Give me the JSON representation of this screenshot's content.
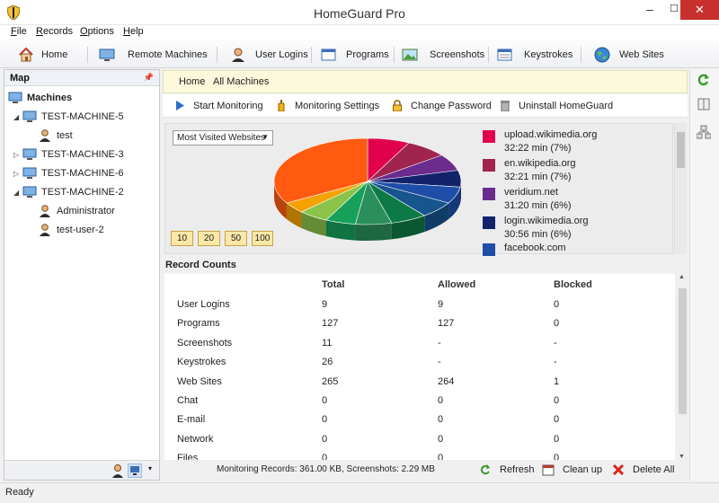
{
  "window": {
    "title": "HomeGuard Pro"
  },
  "menu": [
    {
      "label": "File",
      "key": "F"
    },
    {
      "label": "Records",
      "key": "R"
    },
    {
      "label": "Options",
      "key": "O"
    },
    {
      "label": "Help",
      "key": "H"
    }
  ],
  "toolbar": {
    "home": "Home",
    "remote_machines": "Remote Machines",
    "user_logins": "User Logins",
    "programs": "Programs",
    "screenshots": "Screenshots",
    "keystrokes": "Keystrokes",
    "web_sites": "Web Sites"
  },
  "map": {
    "title": "Map",
    "root": "Machines",
    "nodes": [
      {
        "label": "TEST-MACHINE-5",
        "type": "machine",
        "expanded": true
      },
      {
        "label": "test",
        "type": "user"
      },
      {
        "label": "TEST-MACHINE-3",
        "type": "machine",
        "expanded": false
      },
      {
        "label": "TEST-MACHINE-6",
        "type": "machine",
        "expanded": false
      },
      {
        "label": "TEST-MACHINE-2",
        "type": "machine",
        "expanded": true
      },
      {
        "label": "Administrator",
        "type": "user"
      },
      {
        "label": "test-user-2",
        "type": "user"
      }
    ]
  },
  "breadcrumb": {
    "home": "Home",
    "current": "All Machines"
  },
  "actions": {
    "start_monitoring": "Start Monitoring",
    "monitoring_settings": "Monitoring Settings",
    "change_password": "Change Password",
    "uninstall": "Uninstall HomeGuard"
  },
  "chart_panel": {
    "dropdown_value": "Most Visited Websites",
    "top_buttons": [
      "10",
      "20",
      "50",
      "100"
    ]
  },
  "chart_data": {
    "type": "pie",
    "slices": [
      {
        "label": "upload.wikimedia.org",
        "value": 7,
        "color": "#e0004b"
      },
      {
        "label": "en.wikipedia.org",
        "value": 7,
        "color": "#a0244e"
      },
      {
        "label": "veridium.net",
        "value": 6,
        "color": "#6b2c8e"
      },
      {
        "label": "login.wikimedia.org",
        "value": 6,
        "color": "#13236b"
      },
      {
        "label": "facebook.com",
        "value": 6,
        "color": "#1f4ea8"
      },
      {
        "label": "",
        "value": 6,
        "color": "#16558e"
      },
      {
        "label": "",
        "value": 6,
        "color": "#0d7a46"
      },
      {
        "label": "",
        "value": 6,
        "color": "#2a8f5a"
      },
      {
        "label": "",
        "value": 5,
        "color": "#16a05a"
      },
      {
        "label": "",
        "value": 5,
        "color": "#8bc34a"
      },
      {
        "label": "",
        "value": 4,
        "color": "#f5a100"
      },
      {
        "label": "",
        "value": 32,
        "color": "#ff5a10"
      }
    ],
    "legend": [
      {
        "site": "upload.wikimedia.org",
        "stat": "32:22 min   (7%)",
        "color": "#e0004b"
      },
      {
        "site": "en.wikipedia.org",
        "stat": "32:21 min   (7%)",
        "color": "#a0244e"
      },
      {
        "site": "veridium.net",
        "stat": "31:20 min   (6%)",
        "color": "#6b2c8e"
      },
      {
        "site": "login.wikimedia.org",
        "stat": "30:56 min   (6%)",
        "color": "#13236b"
      },
      {
        "site": "facebook.com",
        "stat": "",
        "color": "#1f4ea8"
      }
    ]
  },
  "record_counts": {
    "title": "Record Counts",
    "columns": [
      "",
      "Total",
      "Allowed",
      "Blocked"
    ],
    "rows": [
      [
        "User Logins",
        "9",
        "9",
        "0"
      ],
      [
        "Programs",
        "127",
        "127",
        "0"
      ],
      [
        "Screenshots",
        "11",
        "-",
        "-"
      ],
      [
        "Keystrokes",
        "26",
        "-",
        "-"
      ],
      [
        "Web Sites",
        "265",
        "264",
        "1"
      ],
      [
        "Chat",
        "0",
        "0",
        "0"
      ],
      [
        "E-mail",
        "0",
        "0",
        "0"
      ],
      [
        "Network",
        "0",
        "0",
        "0"
      ],
      [
        "Files",
        "0",
        "0",
        "0"
      ]
    ]
  },
  "footer": {
    "info": "Monitoring Records: 361.00 KB, Screenshots: 2.29 MB",
    "refresh": "Refresh",
    "clean_up": "Clean up",
    "delete_all": "Delete All"
  },
  "status": "Ready"
}
